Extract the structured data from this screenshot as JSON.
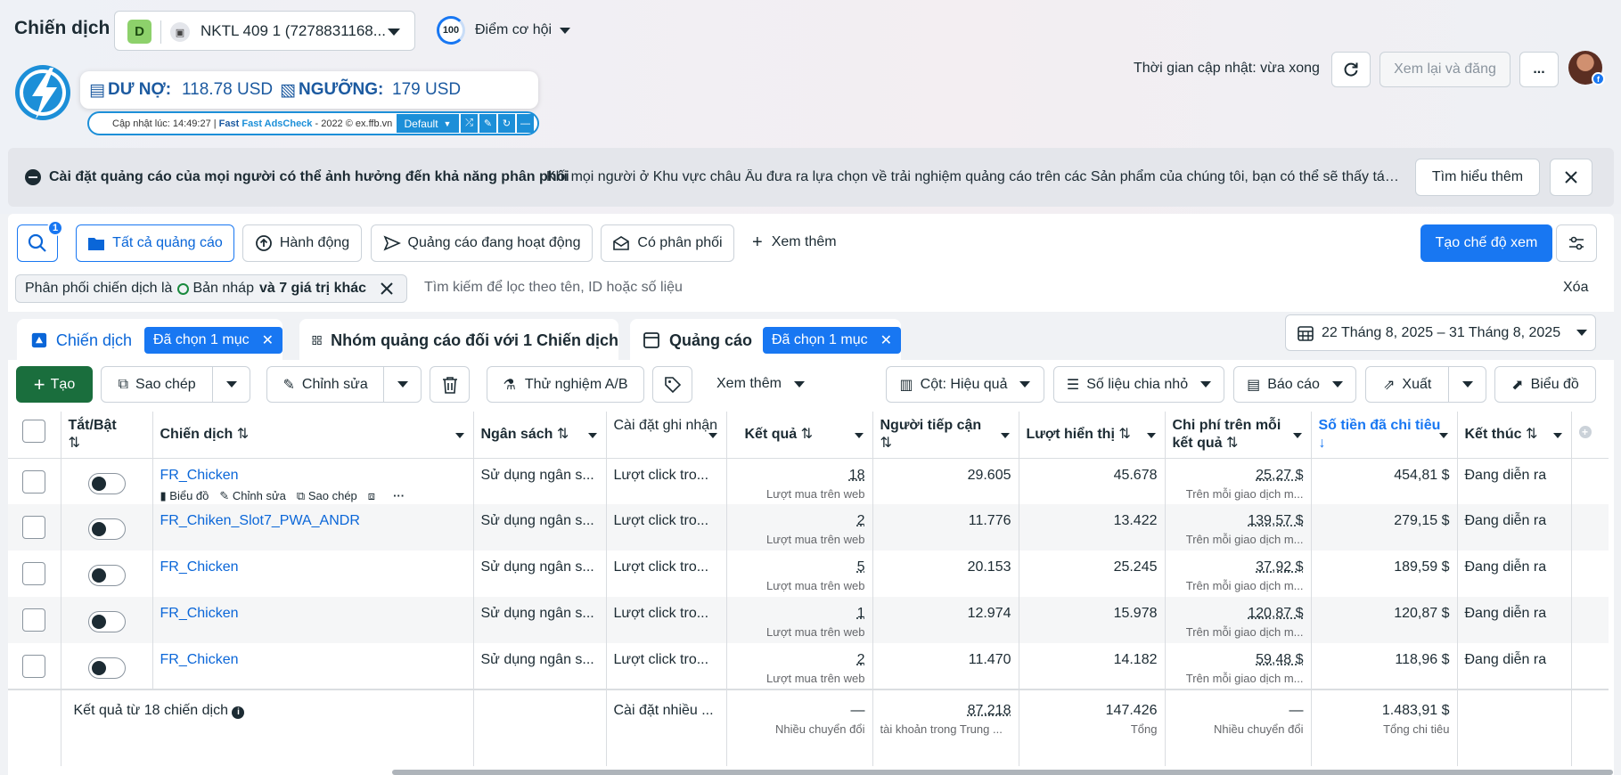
{
  "header": {
    "title": "Chiến dịch",
    "account_badge": "D",
    "account_name": "NKTL 409 1 (7278831168...",
    "score_value": "100",
    "score_label": "Điểm cơ hội",
    "update_text": "Thời gian cập nhật: vừa xong",
    "review_publish": "Xem lại và đăng",
    "more": "..."
  },
  "extension": {
    "debt_label": "DƯ NỢ:",
    "debt_value": "118.78 USD",
    "threshold_label": "NGƯỠNG:",
    "threshold_value": "179 USD",
    "update_prefix": "Cập nhật lúc: 14:49:27 |",
    "brand": "Fast AdsCheck",
    "suffix": "- 2022 © ex.ffb.vn",
    "profile": "Default"
  },
  "notice": {
    "title": "Cài đặt quảng cáo của mọi người có thể ảnh hưởng đến khả năng phân phối",
    "body": "Khi mọi người ở Khu vực châu Âu đưa ra lựa chọn về trải nghiệm quảng cáo trên các Sản phẩm của chúng tôi, bạn có thể sẽ thấy tác đ...",
    "learn_more": "Tìm hiểu thêm"
  },
  "filters": {
    "search_badge": "1",
    "chips": [
      "Tất cả quảng cáo",
      "Hành động",
      "Quảng cáo đang hoạt động",
      "Có phân phối",
      "Xem thêm"
    ],
    "create_view": "Tạo chế độ xem",
    "active_filter_prefix": "Phân phối chiến dịch là",
    "active_filter_value": "Bản nháp",
    "active_filter_suffix": "và 7 giá trị khác",
    "search_placeholder": "Tìm kiếm để lọc theo tên, ID hoặc số liệu",
    "clear": "Xóa"
  },
  "tabs": {
    "campaigns": "Chiến dịch",
    "campaigns_selected": "Đã chọn 1 mục",
    "adsets": "Nhóm quảng cáo đối với 1 Chiến dịch",
    "ads": "Quảng cáo",
    "ads_selected": "Đã chọn 1 mục",
    "date_range": "22 Tháng 8, 2025 – 31 Tháng 8, 2025"
  },
  "toolbar": {
    "create": "Tạo",
    "duplicate": "Sao chép",
    "edit": "Chỉnh sửa",
    "ab_test": "Thử nghiệm A/B",
    "see_more": "Xem thêm",
    "columns": "Cột: Hiệu quả",
    "breakdown": "Số liệu chia nhỏ",
    "reports": "Báo cáo",
    "export": "Xuất",
    "charts": "Biểu đồ"
  },
  "table": {
    "headers": {
      "onoff": "Tắt/Bật",
      "campaign": "Chiến dịch",
      "budget": "Ngân sách",
      "attribution": "Cài đặt ghi nhận",
      "results": "Kết quả",
      "reach": "Người tiếp cận",
      "impressions": "Lượt hiển thị",
      "cost_per_result": "Chi phí trên mỗi kết quả",
      "amount_spent": "Số tiền đã chi tiêu",
      "ends": "Kết thúc"
    },
    "row_actions": {
      "chart": "Biểu đồ",
      "edit": "Chỉnh sửa",
      "duplicate": "Sao chép"
    },
    "rows": [
      {
        "name": "FR_Chicken",
        "budget": "Sử dụng ngân s...",
        "attribution": "Lượt click tro...",
        "results": "18",
        "results_sub": "Lượt mua trên web",
        "reach": "29.605",
        "impressions": "45.678",
        "cpr": "25,27 $",
        "cpr_sub": "Trên mỗi giao dịch m...",
        "spent": "454,81 $",
        "ends": "Đang diễn ra"
      },
      {
        "name": "FR_Chiken_Slot7_PWA_ANDR",
        "budget": "Sử dụng ngân s...",
        "attribution": "Lượt click tro...",
        "results": "2",
        "results_sub": "Lượt mua trên web",
        "reach": "11.776",
        "impressions": "13.422",
        "cpr": "139,57 $",
        "cpr_sub": "Trên mỗi giao dịch m...",
        "spent": "279,15 $",
        "ends": "Đang diễn ra"
      },
      {
        "name": "FR_Chicken",
        "budget": "Sử dụng ngân s...",
        "attribution": "Lượt click tro...",
        "results": "5",
        "results_sub": "Lượt mua trên web",
        "reach": "20.153",
        "impressions": "25.245",
        "cpr": "37,92 $",
        "cpr_sub": "Trên mỗi giao dịch m...",
        "spent": "189,59 $",
        "ends": "Đang diễn ra"
      },
      {
        "name": "FR_Chicken",
        "budget": "Sử dụng ngân s...",
        "attribution": "Lượt click tro...",
        "results": "1",
        "results_sub": "Lượt mua trên web",
        "reach": "12.974",
        "impressions": "15.978",
        "cpr": "120,87 $",
        "cpr_sub": "Trên mỗi giao dịch m...",
        "spent": "120,87 $",
        "ends": "Đang diễn ra"
      },
      {
        "name": "FR_Chicken",
        "budget": "Sử dụng ngân s...",
        "attribution": "Lượt click tro...",
        "results": "2",
        "results_sub": "Lượt mua trên web",
        "reach": "11.470",
        "impressions": "14.182",
        "cpr": "59,48 $",
        "cpr_sub": "Trên mỗi giao dịch m...",
        "spent": "118,96 $",
        "ends": "Đang diễn ra"
      }
    ],
    "total": {
      "label": "Kết quả từ 18 chiến dịch",
      "attribution": "Cài đặt nhiều ...",
      "results": "—",
      "results_sub": "Nhiều chuyển đổi",
      "reach": "87.218",
      "reach_sub": "tài khoản trong Trung ...",
      "impressions": "147.426",
      "impressions_sub": "Tổng",
      "cpr": "—",
      "cpr_sub": "Nhiều chuyển đổi",
      "spent": "1.483,91 $",
      "spent_sub": "Tổng chi tiêu"
    }
  },
  "colors": {
    "primary": "#1877f2",
    "create_green": "#1a6e3d",
    "link": "#0a66d8"
  }
}
